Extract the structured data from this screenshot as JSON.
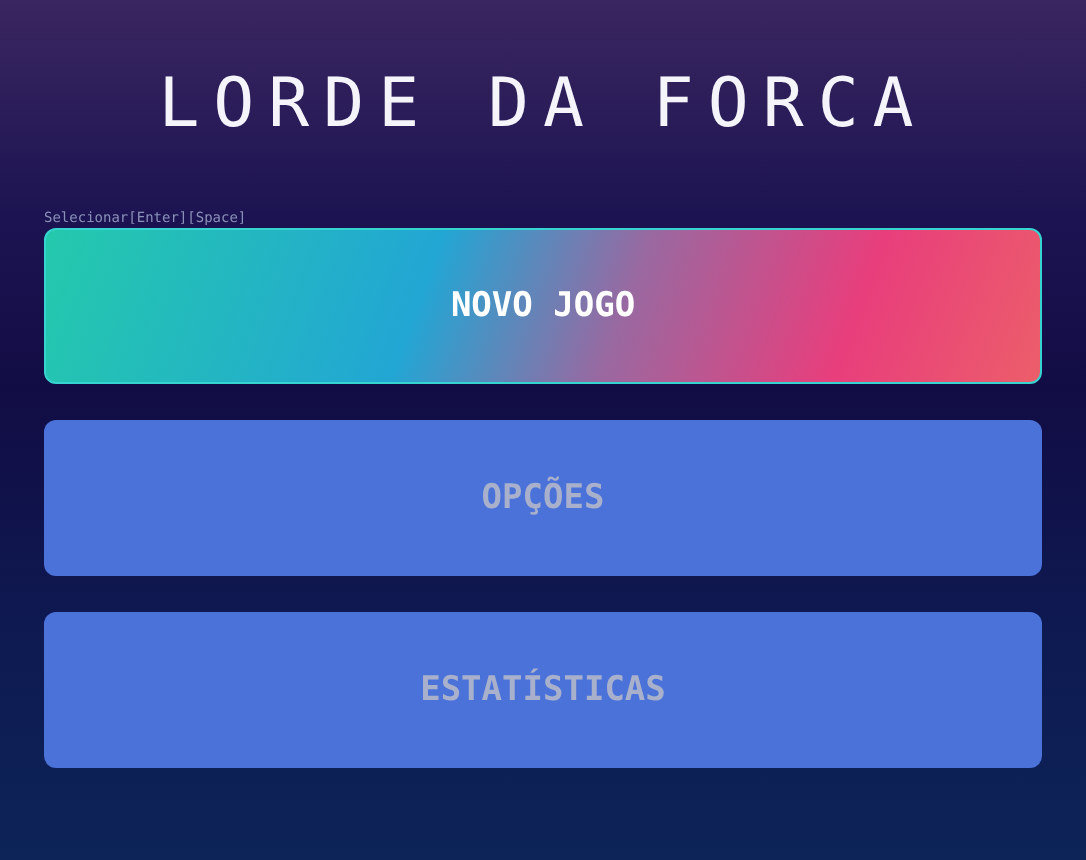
{
  "title": "LORDE DA FORCA",
  "hint": "Selecionar[Enter][Space]",
  "menu": [
    {
      "label": "NOVO JOGO",
      "selected": true
    },
    {
      "label": "OPÇÕES",
      "selected": false
    },
    {
      "label": "ESTATÍSTICAS",
      "selected": false
    }
  ]
}
